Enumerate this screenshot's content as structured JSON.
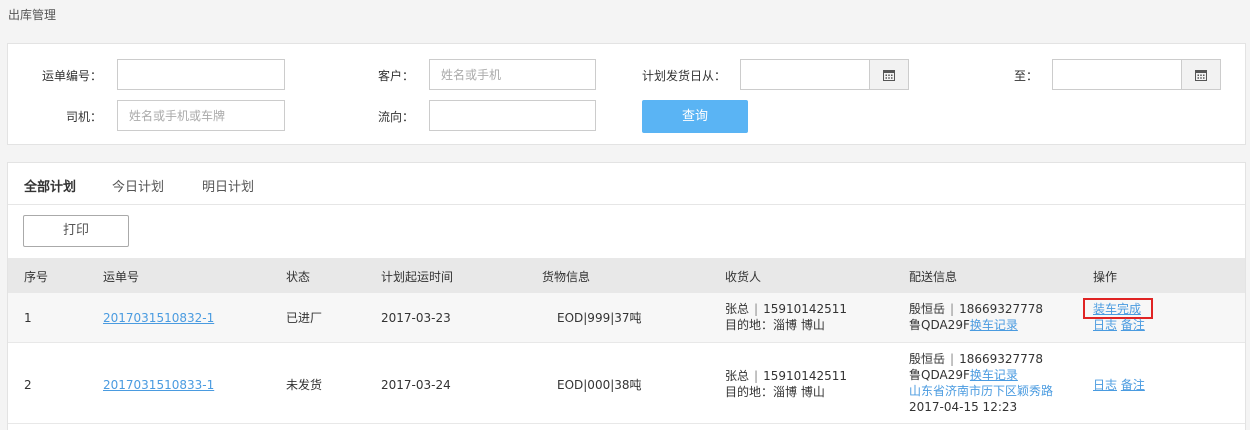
{
  "breadcrumb": "出库管理",
  "filters": {
    "waybill_label": "运单编号：",
    "waybill_value": "",
    "customer_label": "客户：",
    "customer_placeholder": "姓名或手机",
    "plan_from_label": "计划发货日从：",
    "plan_from_value": "",
    "to_label": "至：",
    "to_value": "",
    "driver_label": "司机：",
    "driver_placeholder": "姓名或手机或车牌",
    "flow_label": "流向：",
    "flow_value": "",
    "query_label": "查询"
  },
  "tabs": [
    {
      "label": "全部计划",
      "active": true
    },
    {
      "label": "今日计划",
      "active": false
    },
    {
      "label": "明日计划",
      "active": false
    }
  ],
  "print_label": "打印",
  "table": {
    "headers": [
      "序号",
      "运单号",
      "状态",
      "计划起运时间",
      "货物信息",
      "收货人",
      "配送信息",
      "操作"
    ],
    "rows": [
      {
        "index": "1",
        "waybill": "2017031510832-1",
        "status": "已进厂",
        "plan_time": "2017-03-23",
        "goods": "EOD|999|37吨",
        "receiver_name": "张总",
        "receiver_phone": "15910142511",
        "destination": "目的地：淄博 博山",
        "driver_name": "殷恒岳",
        "driver_phone": "18669327778",
        "plate": "鲁QDA29F",
        "change_record": "换车记录",
        "op_complete": "装车完成",
        "op_log": "日志",
        "op_note": "备注"
      },
      {
        "index": "2",
        "waybill": "2017031510833-1",
        "status": "未发货",
        "plan_time": "2017-03-24",
        "goods": "EOD|000|38吨",
        "receiver_name": "张总",
        "receiver_phone": "15910142511",
        "destination": "目的地：淄博 博山",
        "driver_name": "殷恒岳",
        "driver_phone": "18669327778",
        "plate": "鲁QDA29F",
        "change_record": "换车记录",
        "location": "山东省济南市历下区颖秀路",
        "location_time": "2017-04-15 12:23",
        "op_log": "日志",
        "op_note": "备注"
      }
    ]
  },
  "separator": "|",
  "colors": {
    "accent": "#5ab4f4",
    "link": "#4a9be0",
    "highlight": "#e02424"
  }
}
